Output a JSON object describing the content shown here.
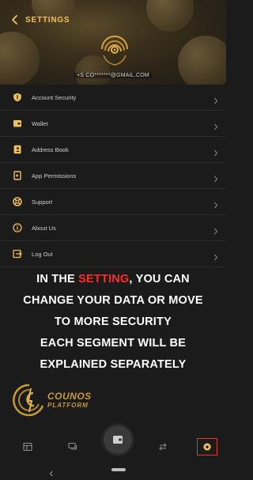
{
  "header": {
    "title": "SETTINGS",
    "email": "+S CO*******@GMAIL.COM"
  },
  "menu": {
    "items": [
      {
        "label": "Account Security",
        "icon": "shield-icon"
      },
      {
        "label": "Wallet",
        "icon": "wallet-icon"
      },
      {
        "label": "Address Book",
        "icon": "address-book-icon"
      },
      {
        "label": "App Permissions",
        "icon": "permissions-icon"
      },
      {
        "label": "Support",
        "icon": "support-icon"
      },
      {
        "label": "About Us",
        "icon": "info-icon"
      },
      {
        "label": "Log Out",
        "icon": "logout-icon"
      }
    ]
  },
  "caption": {
    "line1_prefix": "IN THE ",
    "line1_highlight": "SETTING",
    "line1_suffix": ", YOU CAN",
    "line2": "CHANGE YOUR DATA OR MOVE",
    "line3": "TO MORE SECURITY",
    "line4": "EACH SEGMENT WILL BE",
    "line5": "EXPLAINED SEPARATELY"
  },
  "brand": {
    "name": "COUNOS",
    "sub": "PLATFORM"
  },
  "bottom_nav": {
    "items": [
      "dashboard-icon",
      "chat-icon",
      "wallet-icon",
      "transfer-icon",
      "gear-icon"
    ],
    "active": "gear-icon"
  },
  "colors": {
    "accent": "#f0c15a",
    "highlight": "#ff2b2b",
    "active_border": "#e03a2a",
    "brand": "#c99a3a",
    "background": "#1b1b1b"
  }
}
